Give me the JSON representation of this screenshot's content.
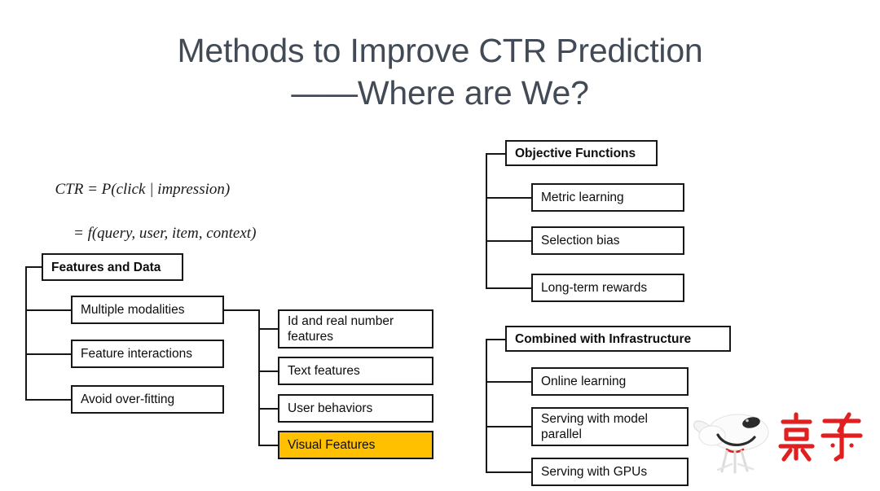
{
  "slide": {
    "title_line1": "Methods to Improve CTR Prediction",
    "title_line2": "——Where are We?",
    "title_color": "#414a55",
    "background_color": "#ffffff"
  },
  "formula": {
    "line1": "CTR = P(click | impression)",
    "line2": "= f(query, user, item, context)"
  },
  "diagrams": {
    "features_and_data": {
      "root": "Features and Data",
      "children": [
        "Multiple modalities",
        "Feature interactions",
        "Avoid over-fitting"
      ],
      "grandchildren_of": "Multiple modalities",
      "grandchildren": [
        "Id and real number features",
        "Text features",
        "User behaviors",
        "Visual Features"
      ],
      "highlighted": "Visual Features",
      "highlight_color": "#FFC000"
    },
    "objective_functions": {
      "root": "Objective Functions",
      "children": [
        "Metric learning",
        "Selection bias",
        "Long-term rewards"
      ]
    },
    "combined_with_infrastructure": {
      "root": "Combined with Infrastructure",
      "children": [
        "Online learning",
        "Serving with model parallel",
        "Serving with GPUs"
      ]
    }
  },
  "logo": {
    "name": "jd-logo",
    "wordmark": "京东",
    "wordmark_color": "#e02020",
    "mascot": "joy-dog-mascot"
  }
}
